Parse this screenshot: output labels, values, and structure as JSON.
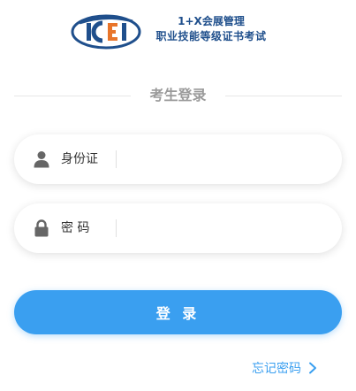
{
  "header": {
    "logo_text": "ICEI",
    "title_line1": "1+X会展管理",
    "title_line2": "职业技能等级证书考试"
  },
  "section": {
    "title": "考生登录"
  },
  "form": {
    "id_label": "身份证",
    "id_value": "",
    "password_label": "密 码",
    "password_value": "",
    "login_label": "登 录"
  },
  "links": {
    "forgot_password": "忘记密码"
  },
  "colors": {
    "accent": "#3a9ff0",
    "brand_blue": "#1f4f8c",
    "logo_orange": "#e8752b",
    "muted_title": "#9a9a9a",
    "icon_gray": "#666666"
  },
  "icons": {
    "logo": "icei-logo",
    "user": "user-icon",
    "lock": "lock-icon",
    "chevron": "chevron-right-icon"
  }
}
